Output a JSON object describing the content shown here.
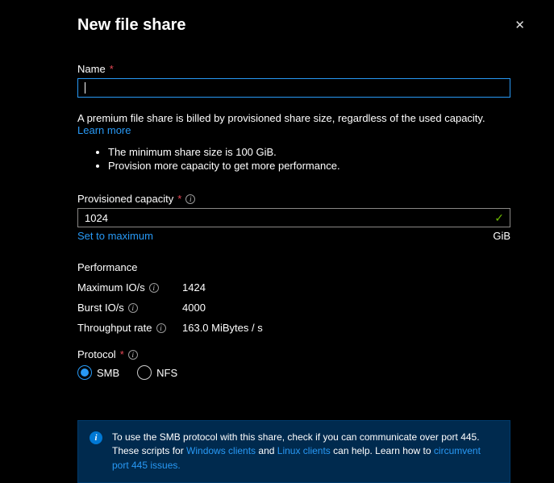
{
  "header": {
    "title": "New file share"
  },
  "name_field": {
    "label": "Name"
  },
  "helper": {
    "billing_text": "A premium file share is billed by provisioned share size, regardless of the used capacity.",
    "learn_more": "Learn more",
    "bullets": [
      "The minimum share size is 100 GiB.",
      "Provision more capacity to get more performance."
    ]
  },
  "capacity": {
    "label": "Provisioned capacity",
    "value": "1024",
    "set_max": "Set to maximum",
    "unit": "GiB"
  },
  "performance": {
    "heading": "Performance",
    "rows": [
      {
        "label": "Maximum IO/s",
        "value": "1424",
        "info": true
      },
      {
        "label": "Burst IO/s",
        "value": "4000",
        "info": true
      },
      {
        "label": "Throughput rate",
        "value": "163.0 MiBytes / s",
        "info": true
      }
    ]
  },
  "protocol": {
    "label": "Protocol",
    "options": [
      {
        "label": "SMB",
        "selected": true
      },
      {
        "label": "NFS",
        "selected": false
      }
    ]
  },
  "info_box": {
    "pre": "To use the SMB protocol with this share, check if you can communicate over port 445. These scripts for ",
    "link1": "Windows clients",
    "mid1": " and ",
    "link2": "Linux clients",
    "mid2": " can help. Learn how to ",
    "link3": "circumvent port 445 issues.",
    "post": ""
  }
}
